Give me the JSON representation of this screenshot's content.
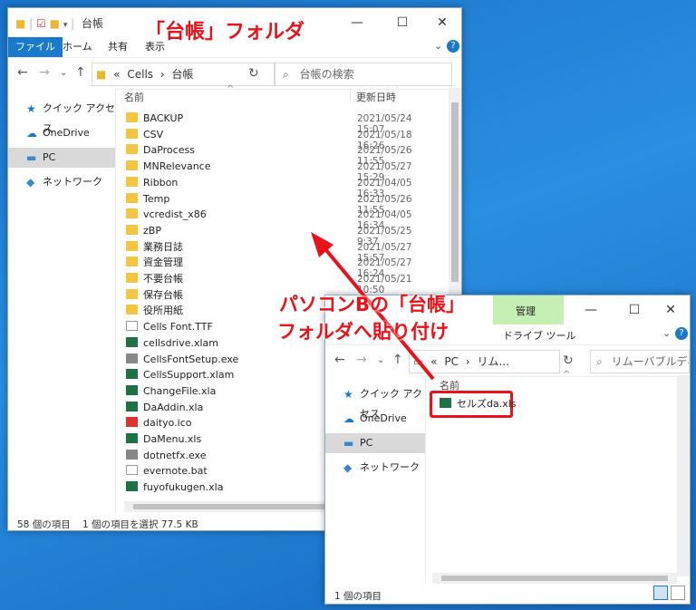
{
  "win1": {
    "title": "台帳",
    "ribbon_tabs": [
      "ファイル",
      "ホーム",
      "共有",
      "表示"
    ],
    "breadcrumb": [
      "«",
      "Cells",
      "›",
      "台帳"
    ],
    "search_placeholder": "台帳の検索",
    "nav": [
      "クイック アクセス",
      "OneDrive",
      "PC",
      "ネットワーク"
    ],
    "col_name": "名前",
    "col_date": "更新日時",
    "files": [
      {
        "name": "BACKUP",
        "date": "2021/05/24 15:07",
        "type": "folder"
      },
      {
        "name": "CSV",
        "date": "2021/05/18 16:26",
        "type": "folder"
      },
      {
        "name": "DaProcess",
        "date": "2021/05/26 11:55",
        "type": "folder"
      },
      {
        "name": "MNRelevance",
        "date": "2021/05/27 15:29",
        "type": "folder"
      },
      {
        "name": "Ribbon",
        "date": "2021/04/05 16:33",
        "type": "folder"
      },
      {
        "name": "Temp",
        "date": "2021/05/26 11:55",
        "type": "folder"
      },
      {
        "name": "vcredist_x86",
        "date": "2021/04/05 16:34",
        "type": "folder"
      },
      {
        "name": "zBP",
        "date": "2021/05/25 9:37",
        "type": "folder"
      },
      {
        "name": "業務日誌",
        "date": "2021/05/27 15:57",
        "type": "folder"
      },
      {
        "name": "資金管理",
        "date": "2021/05/27 16:24",
        "type": "folder"
      },
      {
        "name": "不要台帳",
        "date": "2021/05/21 10:50",
        "type": "folder"
      },
      {
        "name": "保存台帳",
        "date": "",
        "type": "folder"
      },
      {
        "name": "役所用紙",
        "date": "",
        "type": "folder"
      },
      {
        "name": "Cells Font.TTF",
        "date": "",
        "type": "white"
      },
      {
        "name": "cellsdrive.xlam",
        "date": "",
        "type": "excel"
      },
      {
        "name": "CellsFontSetup.exe",
        "date": "",
        "type": "gray"
      },
      {
        "name": "CellsSupport.xlam",
        "date": "",
        "type": "excel"
      },
      {
        "name": "ChangeFile.xla",
        "date": "",
        "type": "excel"
      },
      {
        "name": "DaAddin.xla",
        "date": "",
        "type": "excel"
      },
      {
        "name": "daityo.ico",
        "date": "",
        "type": "red"
      },
      {
        "name": "DaMenu.xls",
        "date": "",
        "type": "excel"
      },
      {
        "name": "dotnetfx.exe",
        "date": "",
        "type": "gray"
      },
      {
        "name": "evernote.bat",
        "date": "",
        "type": "white"
      },
      {
        "name": "fuyofukugen.xla",
        "date": "",
        "type": "excel"
      }
    ],
    "status_count": "58 個の項目",
    "status_selected": "1 個の項目を選択  77.5 KB"
  },
  "win2": {
    "ribbon_manage": "管理",
    "ribbon_tool": "ドライブ ツール",
    "breadcrumb": [
      "«",
      "PC",
      "›",
      "リム..."
    ],
    "search_placeholder": "リムーバブルディスク",
    "nav": [
      "クイック アクセス",
      "OneDrive",
      "PC",
      "ネットワーク"
    ],
    "col_name": "名前",
    "file": "セルズda.xls",
    "status_count": "1 個の項目"
  },
  "annotations": {
    "title": "「台帳」フォルダ",
    "paste_line1": "パソコンBの「台帳」",
    "paste_line2": "フォルダへ貼り付け"
  },
  "colors": {
    "annotation_red": "#e8131a",
    "file_tab": "#1979ca",
    "manage_tab": "#c6efb4"
  }
}
